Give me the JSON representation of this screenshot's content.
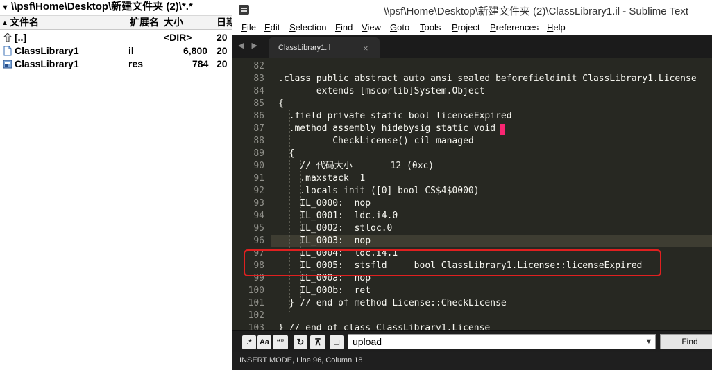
{
  "file_manager": {
    "path": "\\\\psf\\Home\\Desktop\\新建文件夹 (2)\\*.*",
    "columns": [
      "文件名",
      "扩展名",
      "大小",
      "日期"
    ],
    "rows": [
      {
        "name": "[..]",
        "ext": "",
        "size": "<DIR>",
        "date": "20"
      },
      {
        "name": "ClassLibrary1",
        "ext": "il",
        "size": "6,800",
        "date": "20"
      },
      {
        "name": "ClassLibrary1",
        "ext": "res",
        "size": "784",
        "date": "20"
      }
    ]
  },
  "editor": {
    "title": "\\\\psf\\Home\\Desktop\\新建文件夹 (2)\\ClassLibrary1.il - Sublime Text",
    "menu": [
      "File",
      "Edit",
      "Selection",
      "Find",
      "View",
      "Goto",
      "Tools",
      "Project",
      "Preferences",
      "Help"
    ],
    "tab": {
      "label": "ClassLibrary1.il",
      "close": "×"
    },
    "nav_arrows": "◀ ▶",
    "lines": [
      {
        "num": "82",
        "text": ""
      },
      {
        "num": "83",
        "text": ".class public abstract auto ansi sealed beforefieldinit ClassLibrary1.License"
      },
      {
        "num": "84",
        "text": "       extends [mscorlib]System.Object"
      },
      {
        "num": "85",
        "text": "{"
      },
      {
        "num": "86",
        "text": "  .field private static bool licenseExpired"
      },
      {
        "num": "87",
        "text": "  .method assembly hidebysig static void"
      },
      {
        "num": "88",
        "text": "          CheckLicense() cil managed"
      },
      {
        "num": "89",
        "text": "  {"
      },
      {
        "num": "90",
        "text": "    // 代码大小       12 (0xc)"
      },
      {
        "num": "91",
        "text": "    .maxstack  1"
      },
      {
        "num": "92",
        "text": "    .locals init ([0] bool CS$4$0000)"
      },
      {
        "num": "93",
        "text": "    IL_0000:  nop"
      },
      {
        "num": "94",
        "text": "    IL_0001:  ldc.i4.0"
      },
      {
        "num": "95",
        "text": "    IL_0002:  stloc.0"
      },
      {
        "num": "96",
        "text": "    IL_0003:  nop"
      },
      {
        "num": "97",
        "text": "    IL_0004:  ldc.i4.1"
      },
      {
        "num": "98",
        "text": "    IL_0005:  stsfld     bool ClassLibrary1.License::licenseExpired"
      },
      {
        "num": "99",
        "text": "    IL_000a:  nop"
      },
      {
        "num": "100",
        "text": "    IL_000b:  ret"
      },
      {
        "num": "101",
        "text": "  } // end of method License::CheckLicense"
      },
      {
        "num": "102",
        "text": ""
      },
      {
        "num": "103",
        "text": "} // end of class ClassLibrary1.License"
      }
    ],
    "find_panel": {
      "regex": ".*",
      "case": "Aa",
      "whole_word": "“”",
      "wrap": "↻",
      "in_selection": "⊼",
      "highlight": "□",
      "value": "upload",
      "chevron": "▼",
      "find_label": "Find"
    },
    "status": "INSERT MODE, Line 96, Column 18"
  },
  "colors": {
    "editor_bg": "#272822",
    "highlight_box": "#e02020",
    "caret_mark": "#f92672"
  }
}
